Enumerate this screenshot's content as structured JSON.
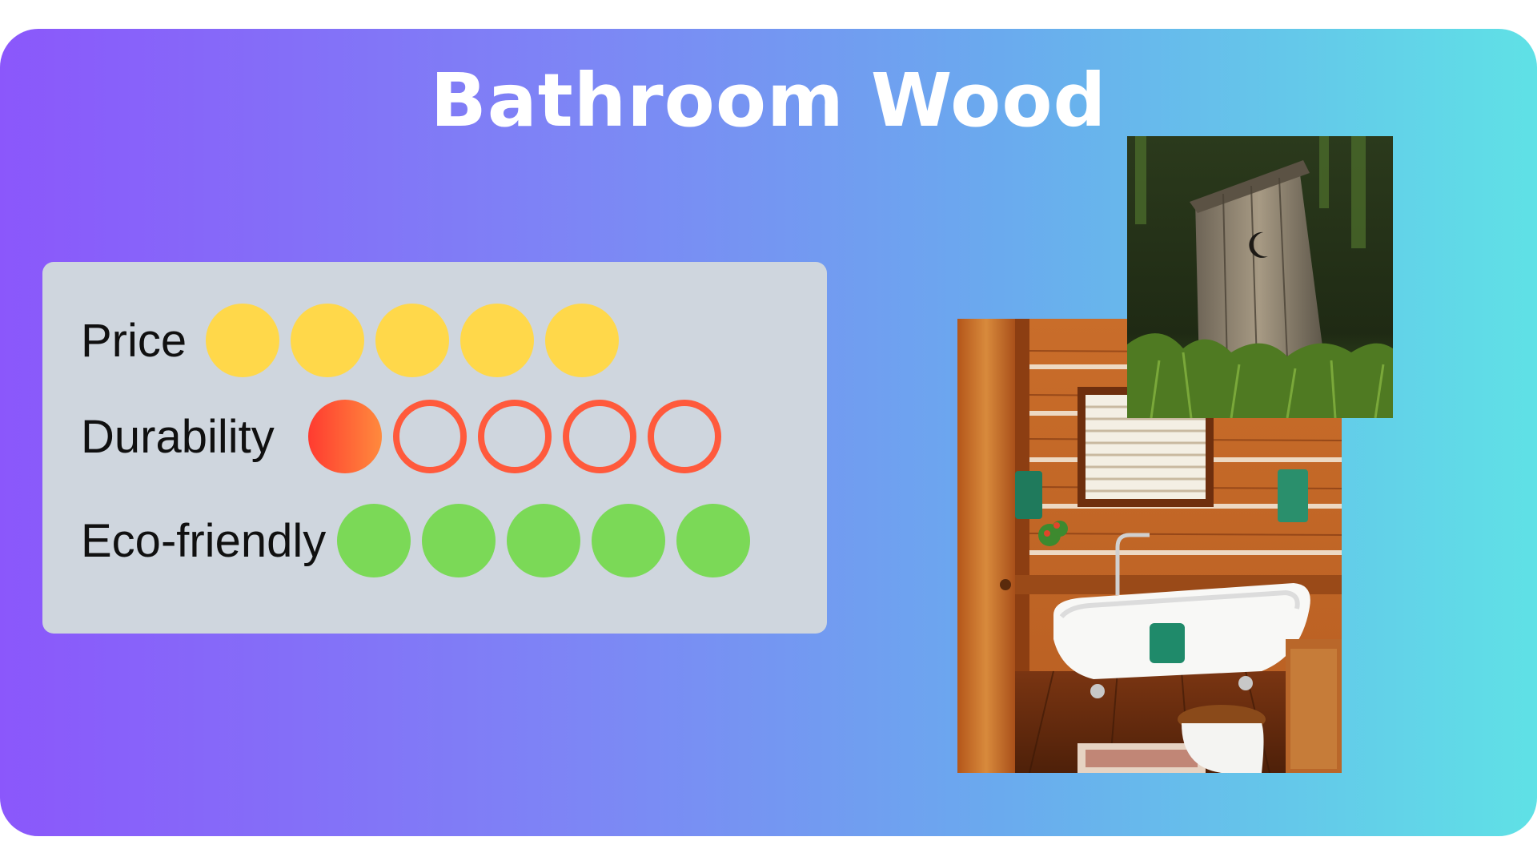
{
  "title": "Bathroom Wood",
  "ratings": [
    {
      "label": "Price",
      "score": 5,
      "max": 5,
      "style": "filled",
      "color": "#ffd84a"
    },
    {
      "label": "Durability",
      "score": 1,
      "max": 5,
      "style": "ring",
      "color": "#ff5a3c"
    },
    {
      "label": "Eco-friendly",
      "score": 5,
      "max": 5,
      "style": "filled",
      "color": "#7bd957"
    }
  ],
  "colors": {
    "gradient_start": "#8b57fb",
    "gradient_end": "#5fe1e6",
    "panel": "#cfd6de"
  }
}
